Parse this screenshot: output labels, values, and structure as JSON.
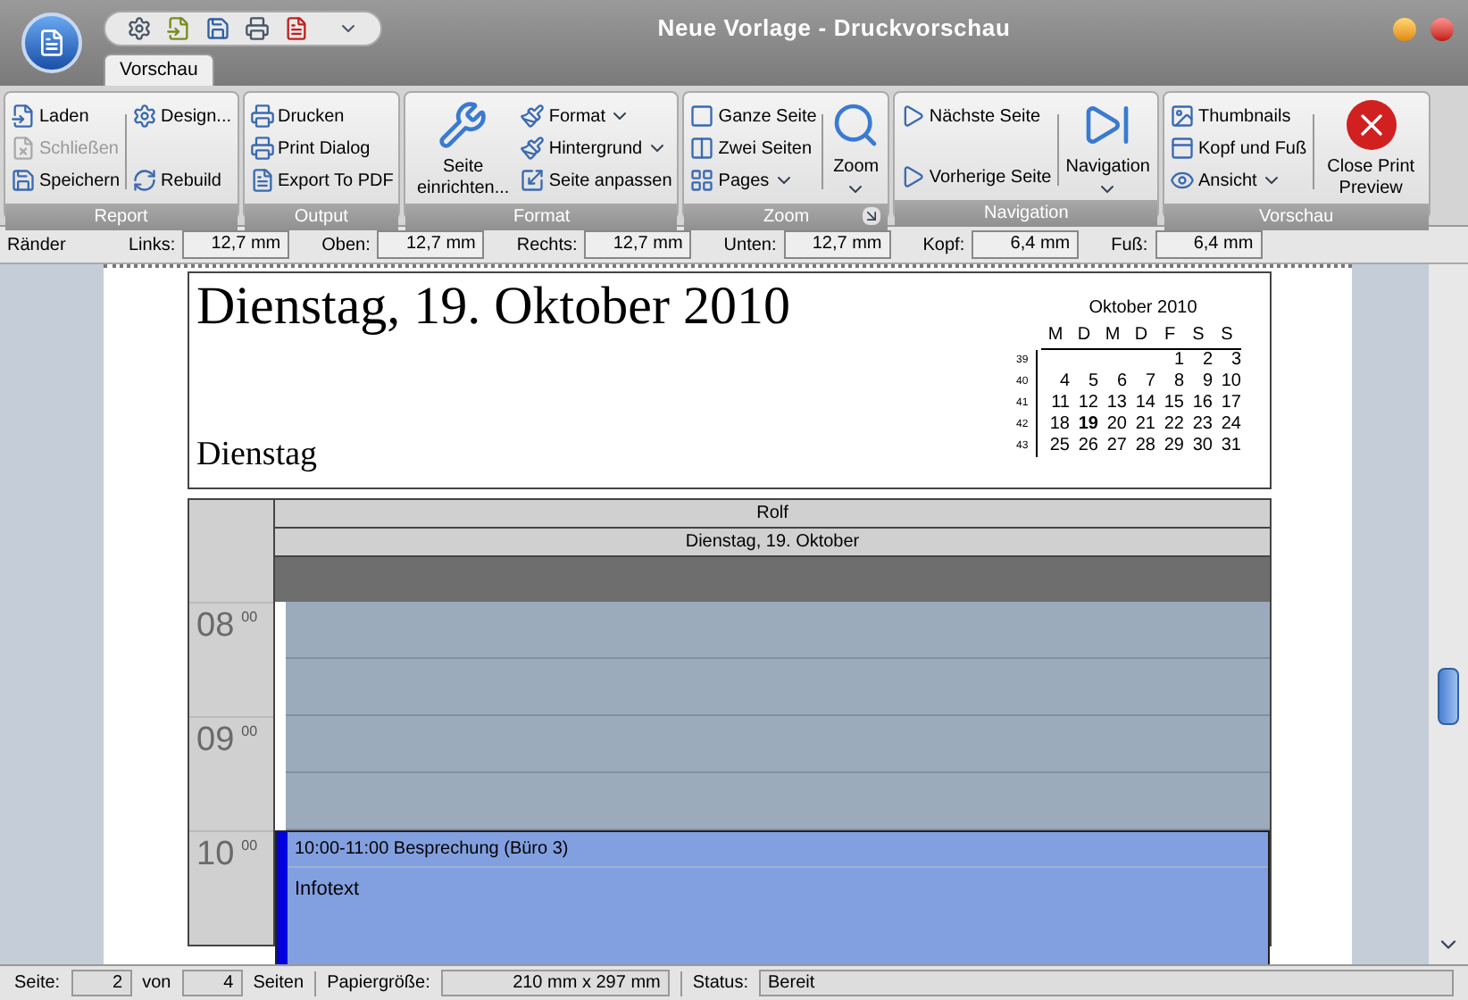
{
  "window": {
    "title": "Neue Vorlage - Druckvorschau"
  },
  "tabs": [
    {
      "label": "Vorschau",
      "selected": true
    }
  ],
  "ribbon": [
    {
      "label": "Report",
      "launcher": false,
      "blocks": [
        {
          "kind": "column",
          "items": [
            {
              "label": "Laden",
              "disabled": false,
              "dropdown": false
            },
            {
              "label": "Schließen",
              "disabled": true,
              "dropdown": false
            },
            {
              "label": "Speichern",
              "disabled": false,
              "dropdown": false
            }
          ]
        },
        {
          "kind": "separator"
        },
        {
          "kind": "column",
          "items": [
            {
              "label": "Design...",
              "disabled": false,
              "dropdown": false
            },
            {
              "label": "Rebuild",
              "disabled": false,
              "dropdown": false
            }
          ]
        }
      ]
    },
    {
      "label": "Output",
      "launcher": false,
      "blocks": [
        {
          "kind": "column",
          "items": [
            {
              "label": "Drucken",
              "disabled": false,
              "dropdown": false
            },
            {
              "label": "Print Dialog",
              "disabled": false,
              "dropdown": false
            },
            {
              "label": "Export To PDF",
              "disabled": false,
              "dropdown": false
            }
          ]
        }
      ]
    },
    {
      "label": "Format",
      "launcher": false,
      "blocks": [
        {
          "kind": "large",
          "label": "Seite einrichten...",
          "dropdown": false
        },
        {
          "kind": "column",
          "items": [
            {
              "label": "Format",
              "disabled": false,
              "dropdown": true
            },
            {
              "label": "Hintergrund",
              "disabled": false,
              "dropdown": true
            },
            {
              "label": "Seite anpassen",
              "disabled": false,
              "dropdown": false
            }
          ]
        }
      ]
    },
    {
      "label": "Zoom",
      "launcher": true,
      "blocks": [
        {
          "kind": "column",
          "items": [
            {
              "label": "Ganze Seite",
              "disabled": false,
              "dropdown": false
            },
            {
              "label": "Zwei Seiten",
              "disabled": false,
              "dropdown": false
            },
            {
              "label": "Pages",
              "disabled": false,
              "dropdown": true
            }
          ]
        },
        {
          "kind": "separator"
        },
        {
          "kind": "large",
          "label": "Zoom",
          "dropdown": true
        }
      ]
    },
    {
      "label": "Navigation",
      "launcher": false,
      "blocks": [
        {
          "kind": "column",
          "items": [
            {
              "label": "Nächste Seite",
              "disabled": false,
              "dropdown": false
            },
            {
              "label": "Vorherige Seite",
              "disabled": false,
              "dropdown": false
            }
          ]
        },
        {
          "kind": "separator"
        },
        {
          "kind": "large",
          "label": "Navigation",
          "dropdown": true
        }
      ]
    },
    {
      "label": "Vorschau",
      "launcher": false,
      "blocks": [
        {
          "kind": "column",
          "items": [
            {
              "label": "Thumbnails",
              "disabled": false,
              "dropdown": false
            },
            {
              "label": "Kopf und Fuß",
              "disabled": false,
              "dropdown": false
            },
            {
              "label": "Ansicht",
              "disabled": false,
              "dropdown": true
            }
          ]
        },
        {
          "kind": "separator"
        },
        {
          "kind": "large",
          "label": "Close Print Preview",
          "dropdown": false
        }
      ]
    }
  ],
  "margins": {
    "label": "Ränder",
    "fields": [
      {
        "label": "Links:",
        "value": "12,7 mm"
      },
      {
        "label": "Oben:",
        "value": "12,7 mm"
      },
      {
        "label": "Rechts:",
        "value": "12,7 mm"
      },
      {
        "label": "Unten:",
        "value": "12,7 mm"
      },
      {
        "label": "Kopf:",
        "value": "6,4 mm"
      },
      {
        "label": "Fuß:",
        "value": "6,4 mm"
      }
    ]
  },
  "page": {
    "heading": "Dienstag, 19. Oktober 2010",
    "subheading": "Dienstag",
    "calendar": {
      "title": "Oktober 2010",
      "weekdays": [
        "M",
        "D",
        "M",
        "D",
        "F",
        "S",
        "S"
      ],
      "weeks": [
        {
          "number": "39",
          "days": [
            {
              "day": "1",
              "selected": false
            },
            {
              "day": "2",
              "selected": false
            },
            {
              "day": "3",
              "selected": false
            }
          ]
        },
        {
          "number": "40",
          "days": [
            {
              "day": "4",
              "selected": false
            },
            {
              "day": "5",
              "selected": false
            },
            {
              "day": "6",
              "selected": false
            },
            {
              "day": "7",
              "selected": false
            },
            {
              "day": "8",
              "selected": false
            },
            {
              "day": "9",
              "selected": false
            },
            {
              "day": "10",
              "selected": false
            }
          ]
        },
        {
          "number": "41",
          "days": [
            {
              "day": "11",
              "selected": false
            },
            {
              "day": "12",
              "selected": false
            },
            {
              "day": "13",
              "selected": false
            },
            {
              "day": "14",
              "selected": false
            },
            {
              "day": "15",
              "selected": false
            },
            {
              "day": "16",
              "selected": false
            },
            {
              "day": "17",
              "selected": false
            }
          ]
        },
        {
          "number": "42",
          "days": [
            {
              "day": "18",
              "selected": false
            },
            {
              "day": "19",
              "selected": true
            },
            {
              "day": "20",
              "selected": false
            },
            {
              "day": "21",
              "selected": false
            },
            {
              "day": "22",
              "selected": false
            },
            {
              "day": "23",
              "selected": false
            },
            {
              "day": "24",
              "selected": false
            }
          ]
        },
        {
          "number": "43",
          "days": [
            {
              "day": "25",
              "selected": false
            },
            {
              "day": "26",
              "selected": false
            },
            {
              "day": "27",
              "selected": false
            },
            {
              "day": "28",
              "selected": false
            },
            {
              "day": "29",
              "selected": false
            },
            {
              "day": "30",
              "selected": false
            },
            {
              "day": "31",
              "selected": false
            }
          ]
        }
      ]
    },
    "schedule": {
      "resource": "Rolf",
      "date": "Dienstag, 19. Oktober",
      "hours": [
        {
          "hour": "08",
          "minutes": "00"
        },
        {
          "hour": "09",
          "minutes": "00"
        },
        {
          "hour": "10",
          "minutes": "00",
          "appointment": {
            "title": "10:00-11:00 Besprechung (Büro 3)",
            "body": "Infotext",
            "color": "#0000e0"
          }
        }
      ]
    }
  },
  "status_bar": [
    {
      "kind": "label",
      "text": "Seite:"
    },
    {
      "kind": "field",
      "text": "2"
    },
    {
      "kind": "label",
      "text": "von"
    },
    {
      "kind": "field",
      "text": "4"
    },
    {
      "kind": "label",
      "text": "Seiten"
    },
    {
      "kind": "separator"
    },
    {
      "kind": "label",
      "text": "Papiergröße:"
    },
    {
      "kind": "wide-field",
      "text": "210 mm x 297 mm"
    },
    {
      "kind": "separator"
    },
    {
      "kind": "label",
      "text": "Status:"
    },
    {
      "kind": "status-field",
      "text": "Bereit"
    }
  ]
}
